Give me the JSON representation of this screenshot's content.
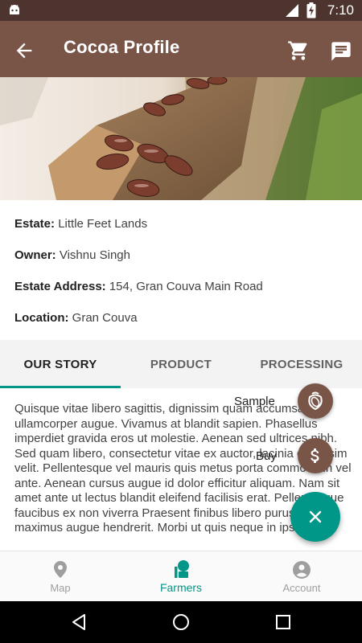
{
  "status_bar": {
    "time": "7:10",
    "network": "LTE"
  },
  "toolbar": {
    "title": "Cocoa Profile"
  },
  "estate": {
    "estate_label": "Estate:",
    "estate_value": "Little Feet Lands",
    "owner_label": "Owner:",
    "owner_value": "Vishnu Singh",
    "address_label": "Estate Address:",
    "address_value": "154, Gran Couva Main Road",
    "location_label": "Location:",
    "location_value": "Gran Couva"
  },
  "tabs": [
    {
      "label": "OUR STORY"
    },
    {
      "label": "PRODUCT"
    },
    {
      "label": "PROCESSING"
    }
  ],
  "story_text": "Quisque vitae libero sagittis, dignissim quam accumsan, ullamcorper augue. Vivamus at blandit sapien. Phasellus imperdiet gravida eros ut molestie. Aenean sed ultrices nibh. Sed quam libero, consectetur vitae ex auctor, lacinia dignissim velit. Pellentesque vel mauris quis metus porta commodo in vel ante. Aenean cursus augue id dolor efficitur aliquam. Nam sit amet ante ut lectus blandit eleifend facilisis erat. Pellentesque faucibus ex non viverra Praesent finibus libero purus, eu maximus augue hendrerit. Morbi ut quis neque in ipsum consectetur lorem.",
  "fab_menu": {
    "sample_label": "Sample",
    "buy_label": "Buy"
  },
  "bottom_nav": [
    {
      "label": "Map",
      "icon": "map-pin-icon"
    },
    {
      "label": "Farmers",
      "icon": "farmer-icon"
    },
    {
      "label": "Account",
      "icon": "account-icon"
    }
  ],
  "colors": {
    "toolbar": "#795548",
    "status_bar": "#4e342e",
    "accent": "#009688",
    "fab_small": "#795548"
  }
}
